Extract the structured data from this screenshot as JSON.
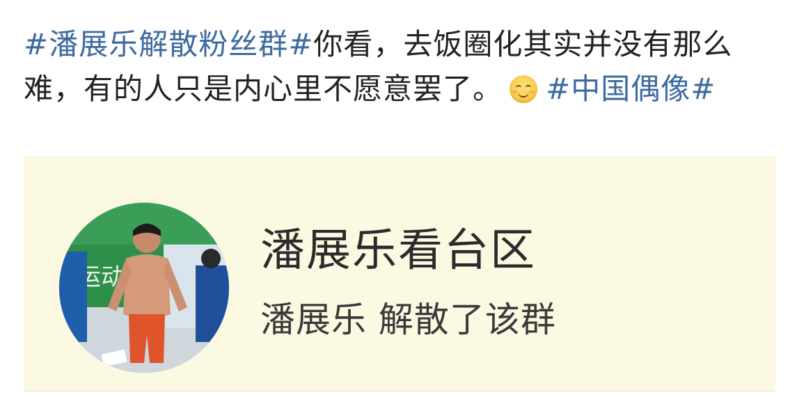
{
  "post": {
    "hashtag_1": "#潘展乐解散粉丝群#",
    "body": "你看，去饭圈化其实并没有那么难，有的人只是内心里不愿意罢了。",
    "emoji": "smile-emoji-icon",
    "hashtag_2": "#中国偶像#"
  },
  "card": {
    "group_name": "潘展乐看台区",
    "status_text": "潘展乐 解散了该群",
    "background_color": "#fbf9e2",
    "avatar_sign_text": "运动"
  },
  "colors": {
    "hashtag": "#3d6aa0",
    "text": "#222222"
  }
}
